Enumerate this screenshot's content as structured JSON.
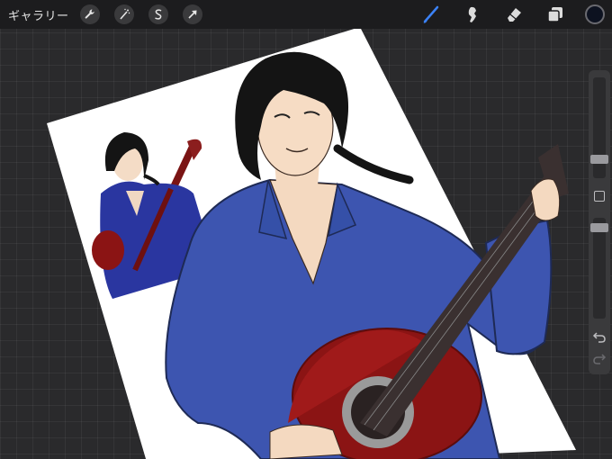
{
  "toolbar": {
    "gallery_label": "ギャラリー",
    "left_tools": [
      {
        "name": "wrench-icon"
      },
      {
        "name": "magic-wand-icon"
      },
      {
        "name": "selection-s-icon"
      },
      {
        "name": "transform-arrow-icon"
      }
    ],
    "right_tools": [
      {
        "name": "brush-icon",
        "active_color": "#3b82f6"
      },
      {
        "name": "smudge-icon"
      },
      {
        "name": "eraser-icon"
      },
      {
        "name": "layers-icon"
      }
    ],
    "current_color": "#0d1220"
  },
  "sidebar": {
    "brush_size": 0.3,
    "opacity": 0.95
  },
  "colors": {
    "shirt": "#3d55b0",
    "guitar_body": "#8b1414",
    "skin": "#f4d9c0",
    "hair": "#141414",
    "canvas_bg": "#ffffff",
    "workspace": "#2a2a2c"
  }
}
